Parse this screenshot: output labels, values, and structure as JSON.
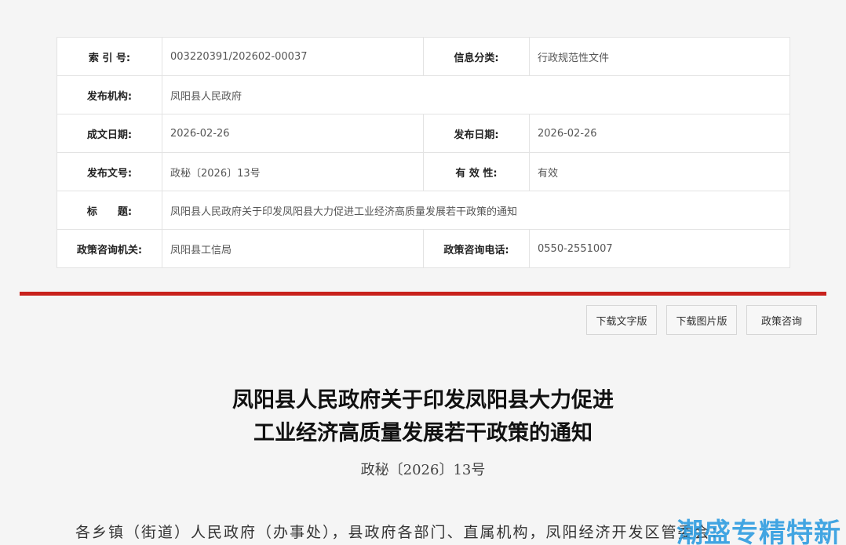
{
  "info_table": {
    "rows": [
      {
        "label1": "索 引 号:",
        "value1": "003220391/202602-00037",
        "label2": "信息分类:",
        "value2": "行政规范性文件"
      },
      {
        "label1": "发布机构:",
        "value1": "凤阳县人民政府"
      },
      {
        "label1": "成文日期:",
        "value1": "2026-02-26",
        "label2": "发布日期:",
        "value2": "2026-02-26"
      },
      {
        "label1": "发布文号:",
        "value1": "政秘〔2026〕13号",
        "label2": "有 效 性:",
        "value2": "有效"
      },
      {
        "label1": "标　　题:",
        "value1": "凤阳县人民政府关于印发凤阳县大力促进工业经济高质量发展若干政策的通知"
      },
      {
        "label1": "政策咨询机关:",
        "value1": "凤阳县工信局",
        "label2": "政策咨询电话:",
        "value2": "0550-2551007"
      }
    ]
  },
  "actions": {
    "download_text": "下载文字版",
    "download_image": "下载图片版",
    "policy_consult": "政策咨询"
  },
  "document": {
    "title_line1": "凤阳县人民政府关于印发凤阳县大力促进",
    "title_line2": "工业经济高质量发展若干政策的通知",
    "number": "政秘〔2026〕13号",
    "body_first_line": "各乡镇（街道）人民政府（办事处），县政府各部门、直属机构，凤阳经济开发区管委会："
  },
  "watermark": "潮盛专精特新",
  "colors": {
    "accent_red": "#c8211c",
    "watermark_blue": "#2a9be0"
  }
}
